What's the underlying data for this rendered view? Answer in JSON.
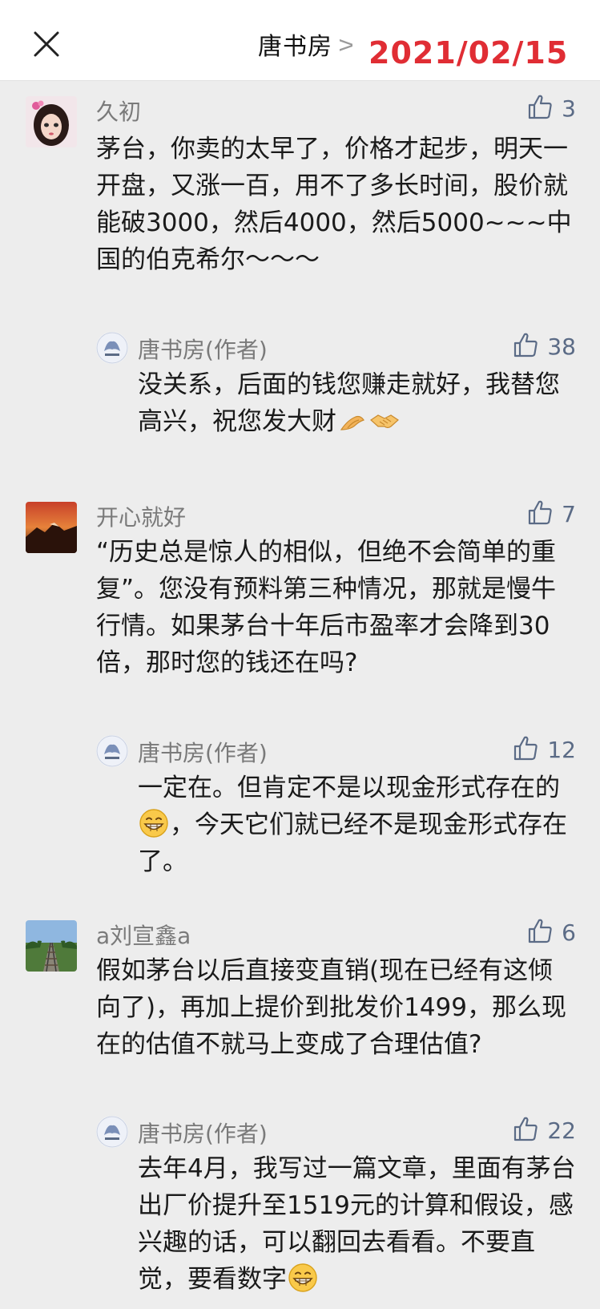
{
  "header": {
    "title": "唐书房",
    "chevron": ">",
    "date": "2021/02/15",
    "more": "••"
  },
  "comments": [
    {
      "name": "久初",
      "likes": "3",
      "text": "茅台，你卖的太早了，价格才起步，明天一开盘，又涨一百，用不了多长时间，股价就能破3000，然后4000，然后5000~~~中国的伯克希尔～～～",
      "reply": {
        "name": "唐书房(作者)",
        "likes": "38",
        "text": "没关系，后面的钱您赚走就好，我替您高兴，祝您发大财"
      }
    },
    {
      "name": "开心就好",
      "likes": "7",
      "text": "“历史总是惊人的相似，但绝不会简单的重复”。您没有预料第三种情况，那就是慢牛行情。如果茅台十年后市盈率才会降到30倍，那时您的钱还在吗?",
      "reply": {
        "name": "唐书房(作者)",
        "likes": "12",
        "text_a": "一定在。但肯定不是以现金形式存在的",
        "text_b": "，今天它们就已经不是现金形式存在了。"
      }
    },
    {
      "name": "a刘宣鑫a",
      "likes": "6",
      "text": "假如茅台以后直接变直销(现在已经有这倾向了)，再加上提价到批发价1499，那么现在的估值不就马上变成了合理估值?",
      "reply": {
        "name": "唐书房(作者)",
        "likes": "22",
        "text": "去年4月，我写过一篇文章，里面有茅台出厂价提升至1519元的计算和假设，感兴趣的话，可以翻回去看看。不要直觉，要看数字"
      }
    }
  ],
  "icons": {
    "close": "close-icon",
    "like": "thumbs-up-icon",
    "emoji_pray": "praying-hands-emoji",
    "emoji_handshake": "handshake-emoji",
    "emoji_grin": "grinning-emoji"
  },
  "colors": {
    "date": "#e02d34",
    "like": "#5b6b86",
    "background": "#ededed"
  }
}
